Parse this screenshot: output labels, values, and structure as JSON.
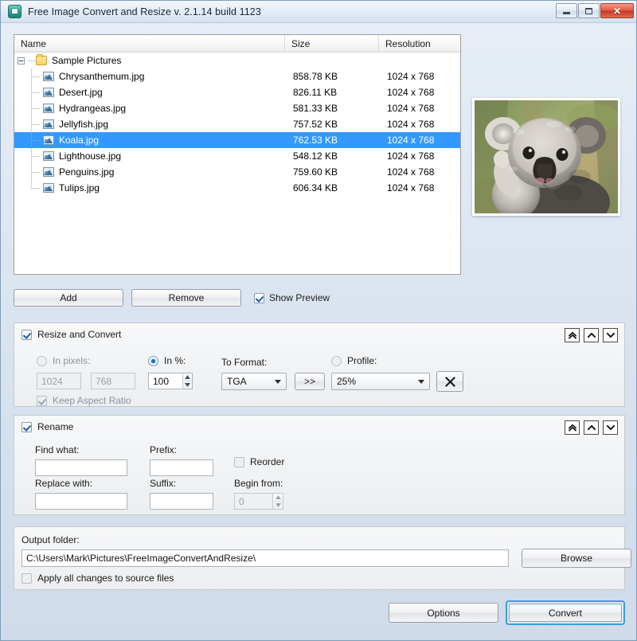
{
  "window": {
    "title": "Free Image Convert and Resize  v. 2.1.14 build 1123",
    "app_icon": "app-icon",
    "controls": {
      "minimize": "minimize-icon",
      "maximize": "maximize-icon",
      "close": "close-icon"
    }
  },
  "file_list": {
    "columns": [
      "Name",
      "Size",
      "Resolution"
    ],
    "root": {
      "label": "Sample Pictures",
      "icon": "folder-icon",
      "expanded": true
    },
    "rows": [
      {
        "name": "Chrysanthemum.jpg",
        "size": "858.78 KB",
        "resolution": "1024 x 768",
        "selected": false
      },
      {
        "name": "Desert.jpg",
        "size": "826.11 KB",
        "resolution": "1024 x 768",
        "selected": false
      },
      {
        "name": "Hydrangeas.jpg",
        "size": "581.33 KB",
        "resolution": "1024 x 768",
        "selected": false
      },
      {
        "name": "Jellyfish.jpg",
        "size": "757.52 KB",
        "resolution": "1024 x 768",
        "selected": false
      },
      {
        "name": "Koala.jpg",
        "size": "762.53 KB",
        "resolution": "1024 x 768",
        "selected": true
      },
      {
        "name": "Lighthouse.jpg",
        "size": "548.12 KB",
        "resolution": "1024 x 768",
        "selected": false
      },
      {
        "name": "Penguins.jpg",
        "size": "759.60 KB",
        "resolution": "1024 x 768",
        "selected": false
      },
      {
        "name": "Tulips.jpg",
        "size": "606.34 KB",
        "resolution": "1024 x 768",
        "selected": false
      }
    ],
    "selection_color": "#3399ff"
  },
  "preview": {
    "alt": "Koala.jpg preview",
    "visible": true
  },
  "list_tools": {
    "add_label": "Add",
    "remove_label": "Remove",
    "show_preview_label": "Show Preview",
    "show_preview_checked": true
  },
  "resize_panel": {
    "title": "Resize and Convert",
    "enabled": true,
    "in_pixels_label": "In pixels:",
    "in_pixels_selected": false,
    "width_value": "1024",
    "height_value": "768",
    "keep_aspect_label": "Keep Aspect Ratio",
    "keep_aspect_checked": true,
    "in_percent_label": "In %:",
    "in_percent_selected": true,
    "percent_value": "100",
    "to_format_label": "To Format:",
    "format_value": "TGA",
    "apply_button_label": ">>",
    "profile_label": "Profile:",
    "profile_selected": false,
    "profile_value": "25%",
    "delete_profile_icon": "x-icon",
    "collapse_all_icon": "double-chevron-up-icon",
    "collapse_icon": "chevron-up-icon",
    "expand_icon": "chevron-down-icon"
  },
  "rename_panel": {
    "title": "Rename",
    "enabled": true,
    "find_what_label": "Find what:",
    "find_what_value": "",
    "replace_with_label": "Replace with:",
    "replace_with_value": "",
    "prefix_label": "Prefix:",
    "prefix_value": "",
    "suffix_label": "Suffix:",
    "suffix_value": "",
    "reorder_label": "Reorder",
    "reorder_checked": false,
    "begin_from_label": "Begin from:",
    "begin_from_value": "0",
    "collapse_all_icon": "double-chevron-up-icon",
    "collapse_icon": "chevron-up-icon",
    "expand_icon": "chevron-down-icon"
  },
  "output_panel": {
    "folder_label": "Output folder:",
    "folder_value": "C:\\Users\\Mark\\Pictures\\FreeImageConvertAndResize\\",
    "browse_label": "Browse",
    "apply_source_label": "Apply all changes to source files",
    "apply_source_checked": false
  },
  "actions": {
    "options_label": "Options",
    "convert_label": "Convert",
    "convert_focused": true,
    "focus_color": "#3a9fdc"
  }
}
